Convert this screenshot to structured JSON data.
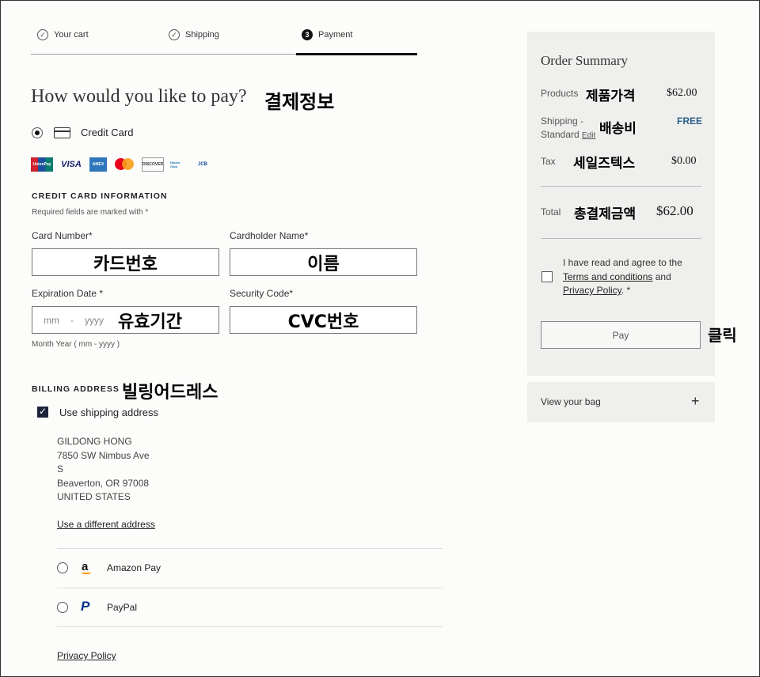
{
  "steps": [
    {
      "label": "Your cart",
      "icon": "check-circle-icon"
    },
    {
      "label": "Shipping",
      "icon": "check-circle-icon"
    },
    {
      "label": "Payment",
      "number": "3"
    }
  ],
  "heading": "How would you like to pay?",
  "heading_annotation": "결제정보",
  "credit_card_label": "Credit Card",
  "brands": [
    "UnionPay",
    "VISA",
    "AMEX",
    "MasterCard",
    "DISCOVER",
    "Diners Club",
    "JCB"
  ],
  "cc_section_title": "CREDIT CARD INFORMATION",
  "required_note": "Required fields are marked with *",
  "card_number_label": "Card Number*",
  "card_number_annotation": "카드번호",
  "cardholder_label": "Cardholder Name*",
  "cardholder_annotation": "이름",
  "expiration_label": "Expiration Date *",
  "exp_mm": "mm",
  "exp_sep": "-",
  "exp_yyyy": "yyyy",
  "expiration_annotation": "유효기간",
  "security_label": "Security Code*",
  "security_annotation": "CVC번호",
  "expiration_hint": "Month Year ( mm - yyyy )",
  "billing_title": "BILLING ADDRESS",
  "billing_annotation": "빌링어드레스",
  "use_shipping_label": "Use shipping address",
  "address": [
    "GILDONG HONG",
    "7850 SW Nimbus Ave",
    "S",
    "Beaverton, OR 97008",
    "UNITED STATES"
  ],
  "different_address": "Use a different address",
  "amazon_pay": "Amazon Pay",
  "paypal": "PayPal",
  "privacy_policy": "Privacy Policy",
  "summary": {
    "title": "Order Summary",
    "products_label": "Products",
    "products_annotation": "제품가격",
    "products_value": "$62.00",
    "shipping_label_1": "Shipping -",
    "shipping_label_2": "Standard",
    "shipping_edit": "Edit",
    "shipping_annotation": "배송비",
    "shipping_value": "FREE",
    "tax_label": "Tax",
    "tax_annotation": "세일즈텍스",
    "tax_value": "$0.00",
    "total_label": "Total",
    "total_annotation": "총결제금액",
    "total_value": "$62.00",
    "agree_text_1": "I have read and agree to the",
    "terms_link": "Terms and conditions",
    "agree_and": "and",
    "privacy_link": "Privacy Policy",
    "agree_end": ". *",
    "pay_button": "Pay",
    "pay_annotation": "클릭",
    "view_bag": "View your bag",
    "view_bag_icon": "plus-icon"
  },
  "colors": {
    "accent": "#1c2439",
    "free": "#2b5f8a",
    "panel": "#efefed"
  }
}
